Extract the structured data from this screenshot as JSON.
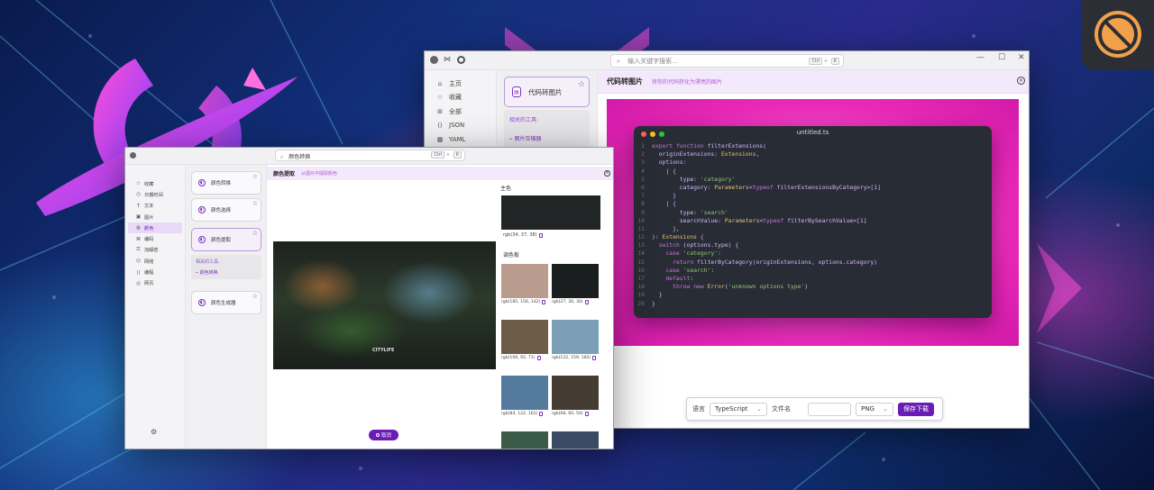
{
  "colors": {
    "accent": "#6b1cb4",
    "accent_light": "#f3e9fb",
    "code_bg": "#282c34"
  },
  "code_window": {
    "search_placeholder": "输入关键字搜索...",
    "search_shortcut": [
      "Ctrl",
      "K"
    ],
    "nav": [
      {
        "icon": "home-icon",
        "label": "主页"
      },
      {
        "icon": "star-icon",
        "label": "收藏"
      },
      {
        "icon": "grid-icon",
        "label": "全部"
      },
      {
        "icon": "json-icon",
        "label": "JSON"
      },
      {
        "icon": "yaml-icon",
        "label": "YAML"
      }
    ],
    "tool_card": "代码转图片",
    "related_label": "相关的工具:",
    "related_items": [
      "图片压缩器"
    ],
    "page_title": "代码转图片",
    "page_subtitle": "将你的代码转化为漂亮的图片",
    "code_file_title": "untitled.ts",
    "code_lines": [
      {
        "n": "1",
        "t": "export function filterExtensions("
      },
      {
        "n": "2",
        "t": "  originExtensions: Extensions,"
      },
      {
        "n": "3",
        "t": "  options:"
      },
      {
        "n": "4",
        "t": "    | {"
      },
      {
        "n": "5",
        "t": "        type: 'category'"
      },
      {
        "n": "6",
        "t": "        category: Parameters<typeof filterExtensionsByCategory>[1]"
      },
      {
        "n": "7",
        "t": "      }"
      },
      {
        "n": "8",
        "t": "    | {"
      },
      {
        "n": "9",
        "t": "        type: 'search'"
      },
      {
        "n": "10",
        "t": "        searchValue: Parameters<typeof filterBySearchValue>[1]"
      },
      {
        "n": "11",
        "t": "      },"
      },
      {
        "n": "12",
        "t": "): Extensions {"
      },
      {
        "n": "13",
        "t": "  switch (options.type) {"
      },
      {
        "n": "14",
        "t": "    case 'category':"
      },
      {
        "n": "15",
        "t": "      return filterByCategory(originExtensions, options.category)"
      },
      {
        "n": "16",
        "t": "    case 'search':"
      },
      {
        "n": "17",
        "t": "    default:"
      },
      {
        "n": "18",
        "t": "      throw new Error('unknown options type')"
      },
      {
        "n": "19",
        "t": "  }"
      },
      {
        "n": "20",
        "t": "}"
      }
    ],
    "bottom": {
      "lang_label": "语言",
      "lang_value": "TypeScript",
      "filename_label": "文件名",
      "filename_value": "",
      "format_value": "PNG",
      "save_button": "保存下载"
    }
  },
  "color_window": {
    "search_value": "颜色转换",
    "search_shortcut": [
      "Ctrl",
      "K"
    ],
    "nav": [
      {
        "icon": "star-icon",
        "label": "收藏"
      },
      {
        "icon": "calendar-icon",
        "label": "日期时间"
      },
      {
        "icon": "text-icon",
        "label": "文本"
      },
      {
        "icon": "image-icon",
        "label": "图片"
      },
      {
        "icon": "palette-icon",
        "label": "颜色"
      },
      {
        "icon": "code-icon",
        "label": "编码"
      },
      {
        "icon": "formatter-icon",
        "label": "加解密"
      },
      {
        "icon": "network-icon",
        "label": "网络"
      },
      {
        "icon": "dev-icon",
        "label": "编程"
      },
      {
        "icon": "web-icon",
        "label": "网页"
      }
    ],
    "tool_cards": [
      "颜色转换",
      "颜色选择",
      "颜色提取",
      "颜色生成器"
    ],
    "related_label": "相关的工具:",
    "related_items": [
      "颜色转换"
    ],
    "page_title": "颜色提取",
    "page_subtitle": "从图片中提取颜色",
    "photo_caption": "CITYLIFE",
    "main_color_label": "主色",
    "main_color": {
      "hex": "#222526",
      "value": "rgb(34, 37, 38)"
    },
    "palette_label": "调色板",
    "palette": [
      {
        "hex": "#b99c8e",
        "value": "rgb(185, 156, 142)"
      },
      {
        "hex": "#1b1e1e",
        "value": "rgb(27, 30, 30)"
      },
      {
        "hex": "#6d5c47",
        "value": "rgb(109, 92, 71)"
      },
      {
        "hex": "#7a9fb6",
        "value": "rgb(122, 159, 182)"
      },
      {
        "hex": "#547a9e",
        "value": "rgb(84, 122, 162)"
      },
      {
        "hex": "#443c32",
        "value": "rgb(68, 60, 50)"
      },
      {
        "hex": "#3c5a48",
        "value": ""
      },
      {
        "hex": "#3a4a64",
        "value": ""
      }
    ],
    "cancel_button": "取消"
  }
}
